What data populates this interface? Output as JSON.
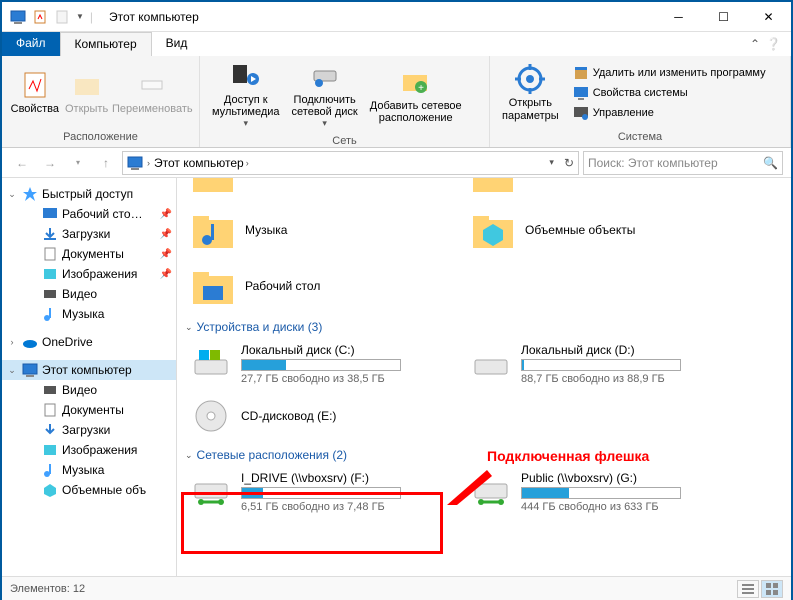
{
  "window": {
    "title": "Этот компьютер"
  },
  "tabs": {
    "file": "Файл",
    "computer": "Компьютер",
    "view": "Вид"
  },
  "ribbon": {
    "group1": {
      "label": "Расположение",
      "props": "Свойства",
      "open": "Открыть",
      "rename": "Переименовать"
    },
    "group2": {
      "label": "Сеть",
      "media": "Доступ к\nмультимедиа",
      "netdrive": "Подключить\nсетевой диск",
      "addnet": "Добавить сетевое\nрасположение"
    },
    "group3": {
      "label": "Система",
      "settings": "Открыть\nпараметры",
      "uninstall": "Удалить или изменить программу",
      "sysprops": "Свойства системы",
      "manage": "Управление"
    }
  },
  "address": {
    "root": "Этот компьютер"
  },
  "search": {
    "placeholder": "Поиск: Этот компьютер"
  },
  "sidebar": {
    "quick": "Быстрый доступ",
    "desktop": "Рабочий сто…",
    "downloads": "Загрузки",
    "documents": "Документы",
    "pictures": "Изображения",
    "videos": "Видео",
    "music": "Музыка",
    "onedrive": "OneDrive",
    "thispc": "Этот компьютер",
    "tpc_videos": "Видео",
    "tpc_documents": "Документы",
    "tpc_downloads": "Загрузки",
    "tpc_pictures": "Изображения",
    "tpc_music": "Музыка",
    "tpc_3d": "Объемные объ"
  },
  "folders": {
    "music": "Музыка",
    "objects3d": "Объемные объекты",
    "desktop": "Рабочий стол"
  },
  "groups": {
    "drives": "Устройства и диски (3)",
    "network": "Сетевые расположения (2)"
  },
  "drives": {
    "c": {
      "name": "Локальный диск (C:)",
      "free": "27,7 ГБ свободно из 38,5 ГБ",
      "pct": 28
    },
    "d": {
      "name": "Локальный диск (D:)",
      "free": "88,7 ГБ свободно из 88,9 ГБ",
      "pct": 1
    },
    "cd": {
      "name": "CD-дисковод (E:)"
    }
  },
  "netdrives": {
    "f": {
      "name": "I_DRIVE (\\\\vboxsrv) (F:)",
      "free": "6,51 ГБ свободно из 7,48 ГБ",
      "pct": 13
    },
    "g": {
      "name": "Public (\\\\vboxsrv) (G:)",
      "free": "444 ГБ свободно из 633 ГБ",
      "pct": 30
    }
  },
  "annotation": {
    "label": "Подключенная флешка"
  },
  "status": {
    "count": "Элементов: 12"
  }
}
